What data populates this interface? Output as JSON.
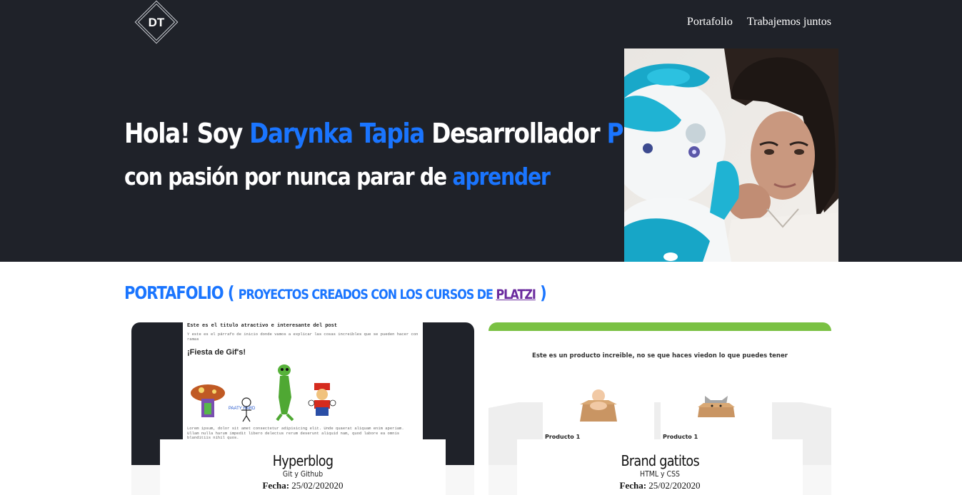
{
  "header": {
    "logo_text": "DT",
    "nav": [
      {
        "label": "Portafolio"
      },
      {
        "label": "Trabajemos juntos"
      }
    ]
  },
  "hero": {
    "line1": {
      "a": "Hola! Soy ",
      "b": "Darynka Tapia",
      "c": " Desarrollador ",
      "d": "PHP"
    },
    "line2": {
      "a": "con pasión por nunca parar de ",
      "b": "aprender"
    },
    "accent_color": "#1a75ff",
    "background_color": "#1f2229"
  },
  "portfolio": {
    "title": "PORTAFOLIO",
    "open_paren": " ( ",
    "subtitle": "PROYECTOS CREADOS CON LOS CURSOS DE ",
    "link": "PLATZI",
    "close_paren": " )",
    "cards": [
      {
        "title": "Hyperblog",
        "subtitle": "Git y Github",
        "date_label": "Fecha:",
        "date": " 25/02/202020",
        "preview": {
          "post_title": "Este es el titulo atractivo e interesante del post",
          "paragraph": "Y este es el párrafo de inicio donde vamos a explicar las cosas increíbles que se pueden hacer con ramas",
          "heading": "¡Fiesta de Gif's!",
          "doodle_text": "PAATY HARD",
          "lorem": "Lorem ipsum, dolor sit amet consectetur adipisicing elit. Unde quaerat aliquam enim aperiam. Ullam nulla harum impedit libero delectus rerum deserunt aliquid nam, quod labore ea omnis blanditiis nihil quos."
        }
      },
      {
        "title": "Brand gatitos",
        "subtitle": "HTML y CSS",
        "date_label": "Fecha:",
        "date": " 25/02/202020",
        "preview": {
          "headline": "Este es un producto increible, no se que haces viedon lo que puedes tener",
          "products": [
            "Producto 1",
            "Producto 1"
          ]
        }
      }
    ]
  }
}
